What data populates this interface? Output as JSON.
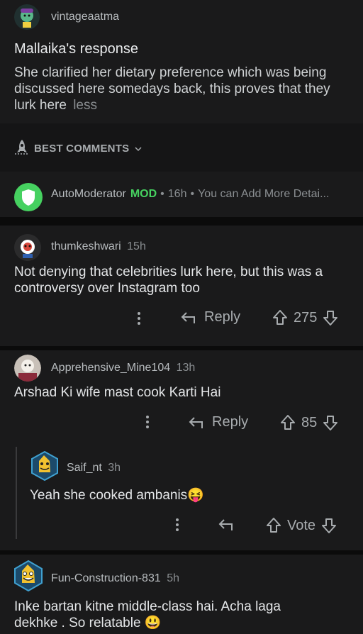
{
  "post": {
    "author": "vintageaatma",
    "title": "Mallaika's response",
    "body": "She clarified her dietary preference which was being discussed here somedays back, this proves that they lurk here",
    "less_link": "less"
  },
  "sort": {
    "label": "BEST COMMENTS"
  },
  "automod": {
    "name": "AutoModerator",
    "mod_badge": "MOD",
    "time": "16h",
    "preview": "You can Add More Detai..."
  },
  "comments": [
    {
      "author": "thumkeshwari",
      "time": "15h",
      "text_line1": "Not denying that celebrities lurk here, but this was a",
      "text_line2": "controversy over Instagram too",
      "reply_label": "Reply",
      "score": "275"
    },
    {
      "author": "Apprehensive_Mine104",
      "time": "13h",
      "text": "Arshad Ki wife mast cook Karti Hai",
      "reply_label": "Reply",
      "score": "85",
      "reply": {
        "author": "Saif_nt",
        "time": "3h",
        "text": "Yeah she cooked ambanis😝",
        "vote_label": "Vote"
      }
    },
    {
      "author": "Fun-Construction-831",
      "time": "5h",
      "text_line1": "Inke bartan kitne middle-class hai. Acha laga",
      "text_line2": "dekhke . So relatable 😃"
    }
  ],
  "colors": {
    "mod_green": "#46d160",
    "background": "#1a1a1b",
    "separator": "#0b0b0b"
  }
}
